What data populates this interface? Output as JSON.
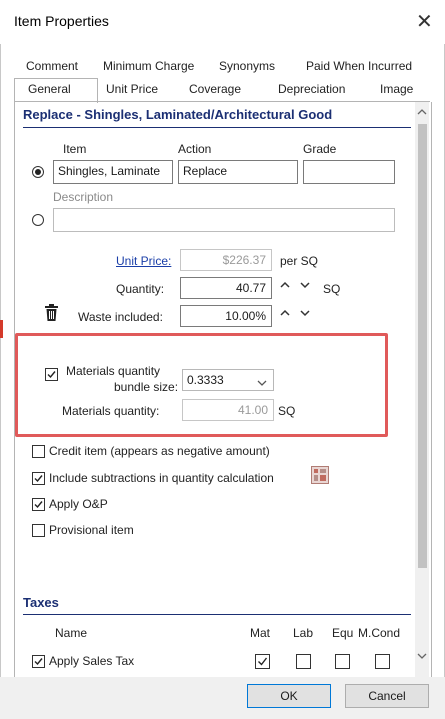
{
  "window": {
    "title": "Item Properties",
    "close_glyph": "✕"
  },
  "tabs_row1": [
    "Comment",
    "Minimum Charge",
    "Synonyms",
    "Paid When Incurred"
  ],
  "tabs_row2": [
    "General",
    "Unit Price",
    "Coverage",
    "Depreciation",
    "Image"
  ],
  "active_tab": "General",
  "header": {
    "title": "Replace - Shingles, Laminated/Architectural Good"
  },
  "item_section": {
    "item_label": "Item",
    "action_label": "Action",
    "grade_label": "Grade",
    "item_value": "Shingles, Laminate",
    "action_value": "Replace",
    "grade_value": "",
    "description_label": "Description",
    "description_value": ""
  },
  "pricing": {
    "unit_price_label": "Unit Price:",
    "unit_price_value": "$226.37",
    "unit_price_unit": "per SQ",
    "quantity_label": "Quantity:",
    "quantity_value": "40.77",
    "quantity_unit": "SQ",
    "waste_label": "Waste included:",
    "waste_value": "10.00%"
  },
  "materials": {
    "bundle_label_line1": "Materials quantity",
    "bundle_label_line2": "bundle size:",
    "bundle_checked": true,
    "bundle_value": "0.3333",
    "quantity_label": "Materials quantity:",
    "quantity_value": "41.00",
    "quantity_unit": "SQ"
  },
  "options": [
    {
      "label": "Credit item (appears as negative amount)",
      "checked": false
    },
    {
      "label": "Include subtractions in quantity calculation",
      "checked": true
    },
    {
      "label": "Apply O&P",
      "checked": true
    },
    {
      "label": "Provisional item",
      "checked": false
    }
  ],
  "taxes": {
    "title": "Taxes",
    "col_name": "Name",
    "col_mat": "Mat",
    "col_lab": "Lab",
    "col_equ": "Equ",
    "col_mcond": "M.Cond",
    "row": {
      "label": "Apply Sales Tax",
      "checked": true,
      "mat": true,
      "lab": false,
      "equ": false,
      "mcond": false
    }
  },
  "buttons": {
    "ok": "OK",
    "cancel": "Cancel"
  },
  "icons": {
    "trash": "trash-icon",
    "calculator": "calculator-icon",
    "radio_selected": "radio-selected",
    "spinner_up": "▲",
    "spinner_down": "▼",
    "dropdown": "chevron-down-icon"
  },
  "colors": {
    "section_title": "#1b2f73",
    "highlight_border": "#e05a5a",
    "link": "#1a3ea8"
  }
}
